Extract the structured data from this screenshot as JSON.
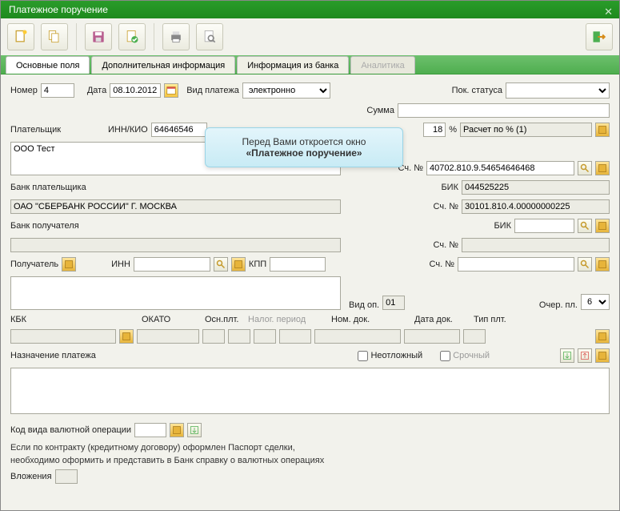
{
  "title": "Платежное поручение",
  "tabs": {
    "t0": "Основные поля",
    "t1": "Дополнительная информация",
    "t2": "Информация из банка",
    "t3": "Аналитика"
  },
  "r1": {
    "num_lbl": "Номер",
    "num": "4",
    "date_lbl": "Дата",
    "date": "08.10.2012",
    "paytype_lbl": "Вид платежа",
    "paytype": "электронно",
    "status_lbl": "Пок. статуса"
  },
  "r2": {
    "sum_lbl": "Сумма",
    "sum": ""
  },
  "r3": {
    "payer_lbl": "Плательщик",
    "innkio_lbl": "ИНН/КИО",
    "innkio": "64646546",
    "nds_pct": "18",
    "pct": "%",
    "calc": "Расчет по % (1)"
  },
  "r4": {
    "payer_name": "ООО Тест"
  },
  "r5": {
    "acc_lbl": "Сч. №",
    "acc": "40702.810.9.54654646468"
  },
  "r6": {
    "bank_lbl": "Банк плательщика",
    "bik_lbl": "БИК",
    "bik": "044525225"
  },
  "r7": {
    "bank_name": "ОАО \"СБЕРБАНК РОССИИ\" Г. МОСКВА",
    "acc_lbl": "Сч. №",
    "acc": "30101.810.4.00000000225"
  },
  "r8": {
    "bank2_lbl": "Банк получателя",
    "bik_lbl": "БИК",
    "bik": ""
  },
  "r9": {
    "acc_lbl": "Сч. №",
    "acc": ""
  },
  "r10": {
    "recv_lbl": "Получатель",
    "inn_lbl": "ИНН",
    "inn": "",
    "kpp_lbl": "КПП",
    "kpp": "",
    "acc_lbl": "Сч. №",
    "acc": ""
  },
  "r11": {
    "recv_name": "",
    "op_lbl": "Вид оп.",
    "op": "01",
    "queue_lbl": "Очер. пл.",
    "queue": "6"
  },
  "r12": {
    "kbk_lbl": "КБК",
    "okato_lbl": "ОКАТО",
    "osn_lbl": "Осн.плт.",
    "nal_ph": "Налог. период",
    "nomdok_lbl": "Ном. док.",
    "datadok_lbl": "Дата док.",
    "typeplt_lbl": "Тип плт."
  },
  "r13": {
    "purpose_lbl": "Назначение платежа",
    "urgent1": "Неотложный",
    "urgent2": "Срочный"
  },
  "r14": {
    "code_lbl": "Код вида валютной операции",
    "code": ""
  },
  "r15": {
    "note1": "Если по контракту (кредитному договору) оформлен Паспорт сделки,",
    "note2": "необходимо оформить и представить в Банк справку о валютных операциях",
    "attach_lbl": "Вложения"
  },
  "tooltip": {
    "l1": "Перед Вами откроется окно",
    "l2": "«Платежное поручение»"
  }
}
